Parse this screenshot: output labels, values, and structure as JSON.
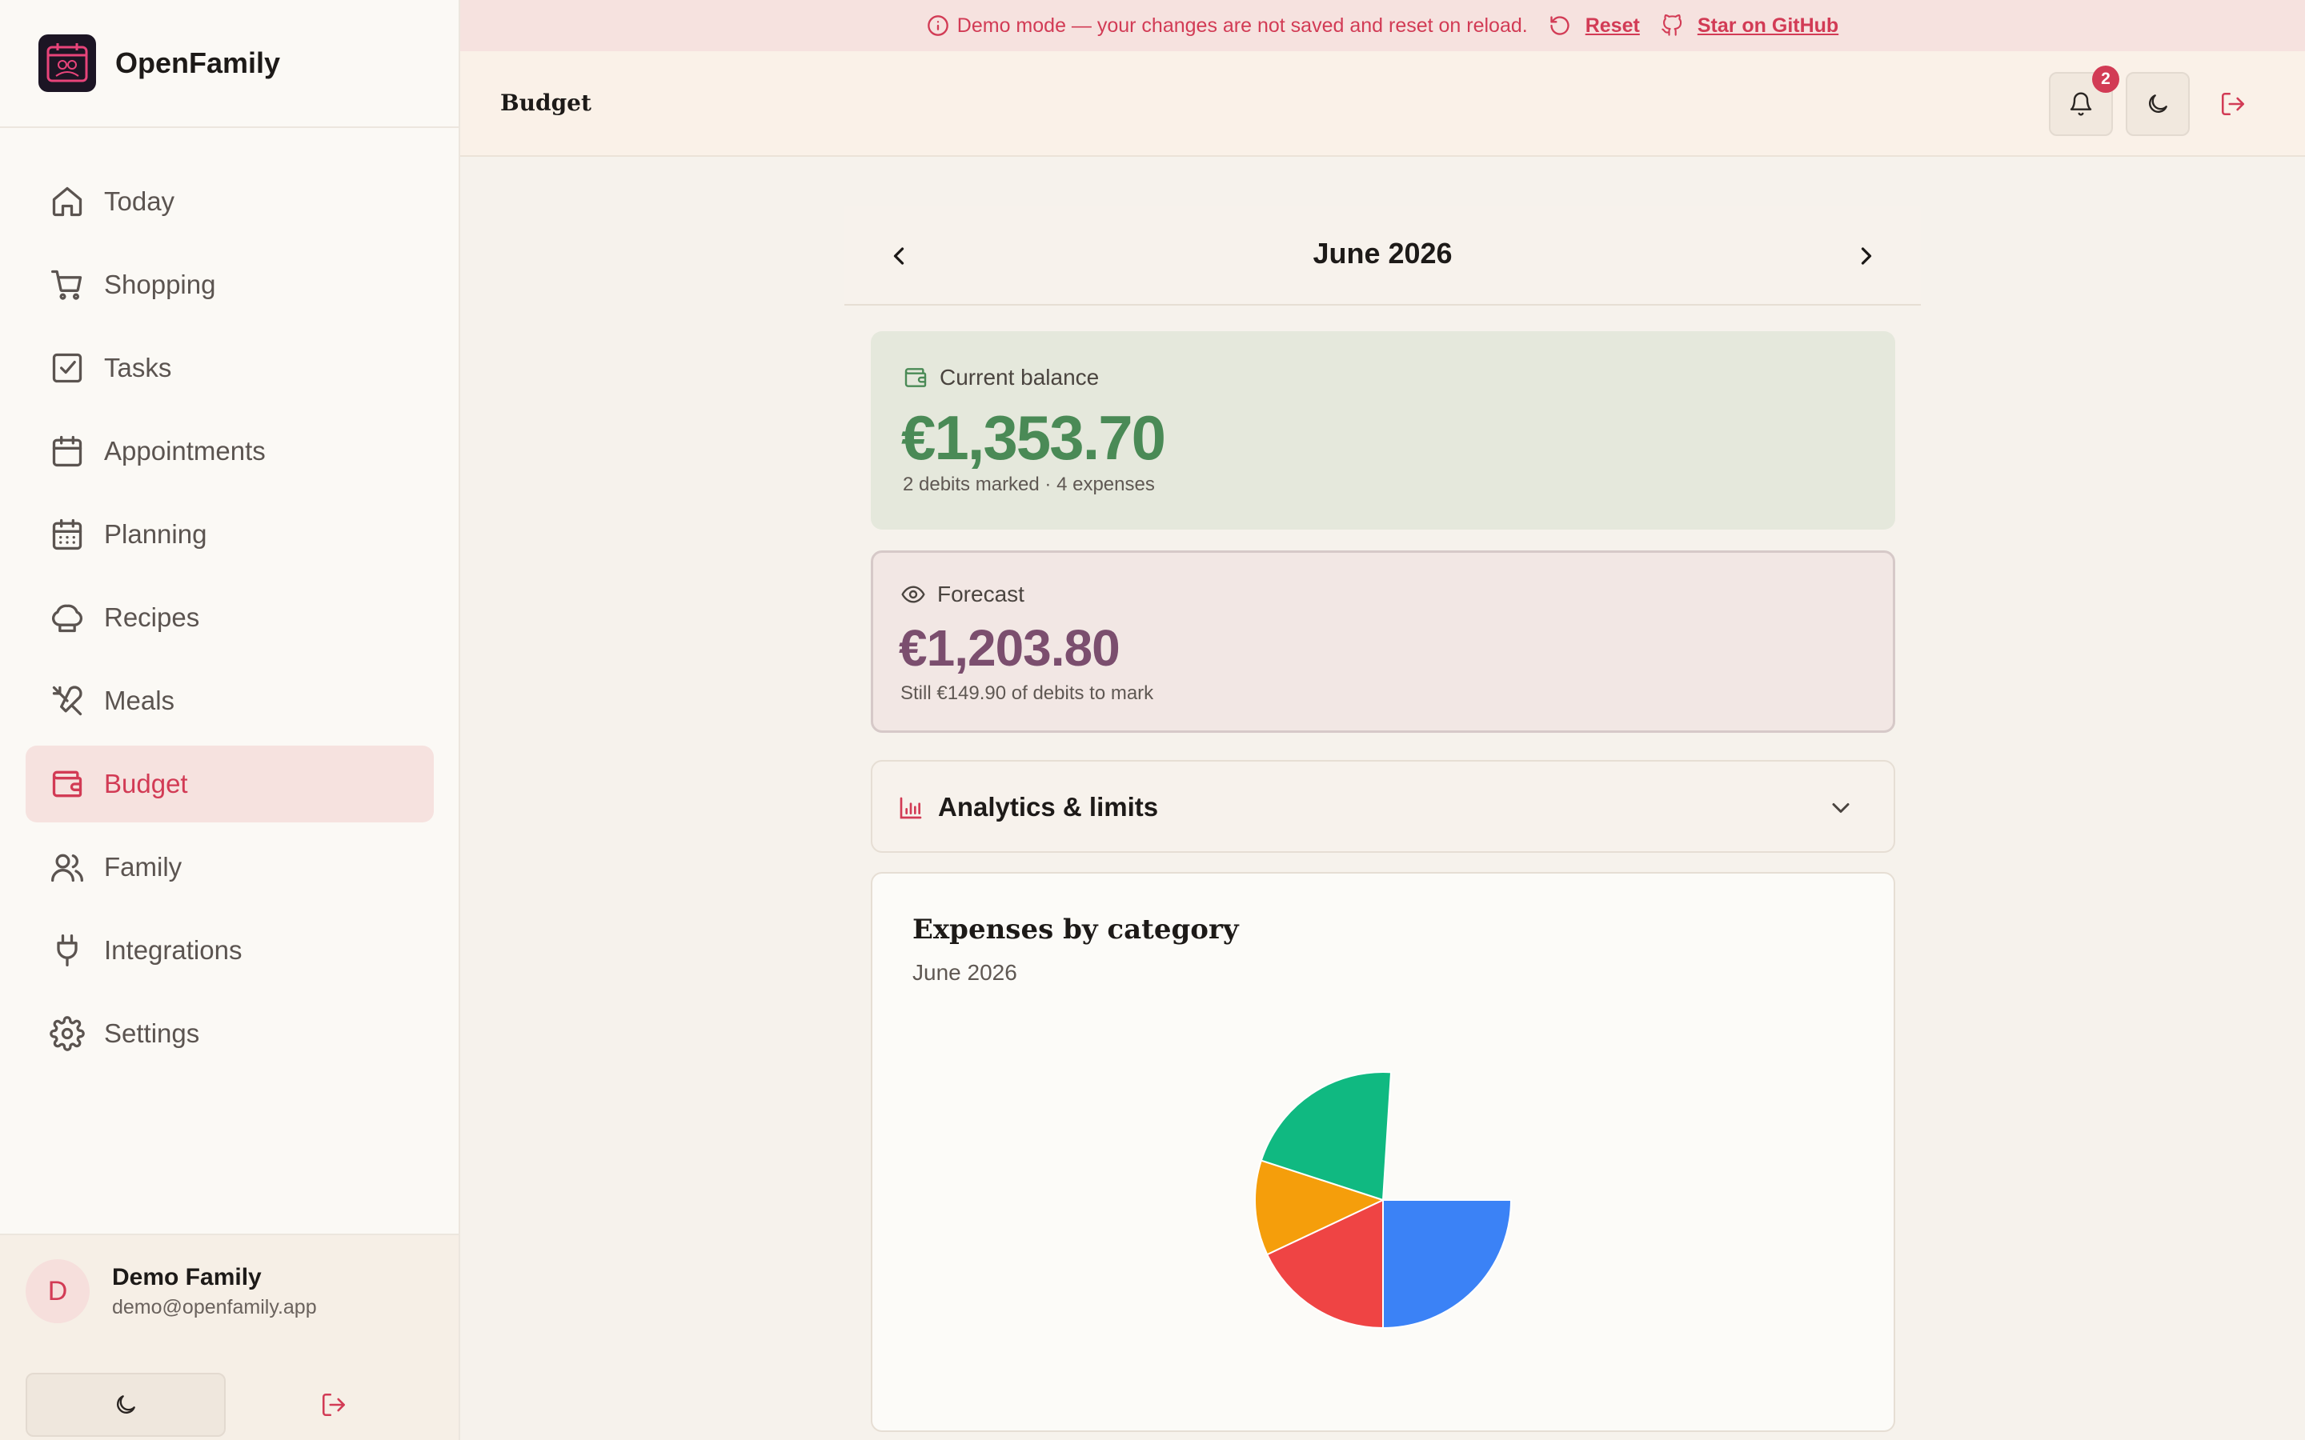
{
  "app": {
    "name": "OpenFamily"
  },
  "banner": {
    "message": "Demo mode — your changes are not saved and reset on reload.",
    "reset_label": "Reset",
    "github_label": "Star on GitHub"
  },
  "header": {
    "title": "Budget",
    "notification_count": "2"
  },
  "sidebar": {
    "items": [
      {
        "label": "Today",
        "icon": "home-icon"
      },
      {
        "label": "Shopping",
        "icon": "cart-icon"
      },
      {
        "label": "Tasks",
        "icon": "checkbox-icon"
      },
      {
        "label": "Appointments",
        "icon": "calendar-icon"
      },
      {
        "label": "Planning",
        "icon": "calendar-grid-icon"
      },
      {
        "label": "Recipes",
        "icon": "chef-hat-icon"
      },
      {
        "label": "Meals",
        "icon": "utensils-icon"
      },
      {
        "label": "Budget",
        "icon": "wallet-icon",
        "active": true
      },
      {
        "label": "Family",
        "icon": "users-icon"
      },
      {
        "label": "Integrations",
        "icon": "plug-icon"
      },
      {
        "label": "Settings",
        "icon": "gear-icon"
      }
    ],
    "user": {
      "initial": "D",
      "name": "Demo Family",
      "email": "demo@openfamily.app"
    }
  },
  "month": {
    "label": "June 2026"
  },
  "balance": {
    "label": "Current balance",
    "amount": "€1,353.70",
    "detail": "2 debits marked · 4 expenses"
  },
  "forecast": {
    "label": "Forecast",
    "amount": "€1,203.80",
    "detail": "Still €149.90 of debits to mark"
  },
  "analytics": {
    "label": "Analytics & limits"
  },
  "colors": {
    "accent": "#d23b55",
    "balance_green": "#4a8a56",
    "forecast_purple": "#7b4e6e"
  },
  "chart": {
    "title": "Expenses by category",
    "subtitle": "June 2026"
  },
  "chart_data": {
    "type": "pie",
    "title": "Expenses by category",
    "subtitle": "June 2026",
    "slices": [
      {
        "value": 25.0,
        "color": "#3b82f6"
      },
      {
        "value": 18.0,
        "color": "#ef4444"
      },
      {
        "value": 12.0,
        "color": "#f59e0b"
      },
      {
        "value": 21.0,
        "color": "#10b981"
      }
    ],
    "start_angle_deg": 0
  }
}
